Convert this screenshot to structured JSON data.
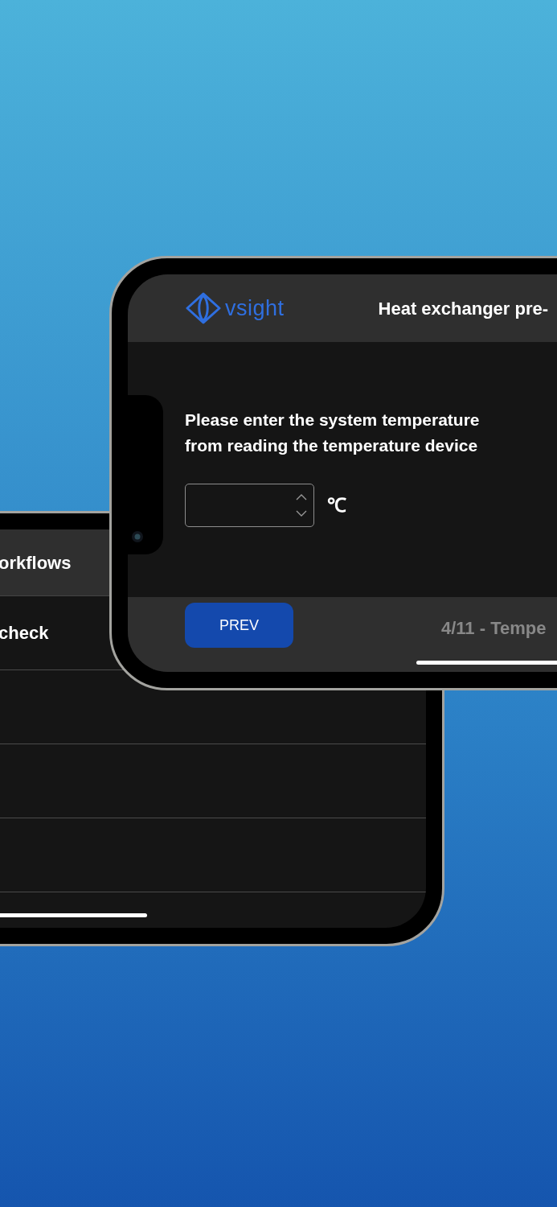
{
  "back_phone": {
    "header_title": "orkflows",
    "rows": [
      {
        "title": "check"
      }
    ]
  },
  "front_phone": {
    "logo": {
      "text": "vsight"
    },
    "title": "Heat exchanger pre-",
    "question": "Please enter the system temperature from reading the temperature device",
    "temperature_field": {
      "unit": "℃"
    },
    "footer": {
      "prev_button": "PREV",
      "step": "4/11 - Tempe"
    }
  }
}
